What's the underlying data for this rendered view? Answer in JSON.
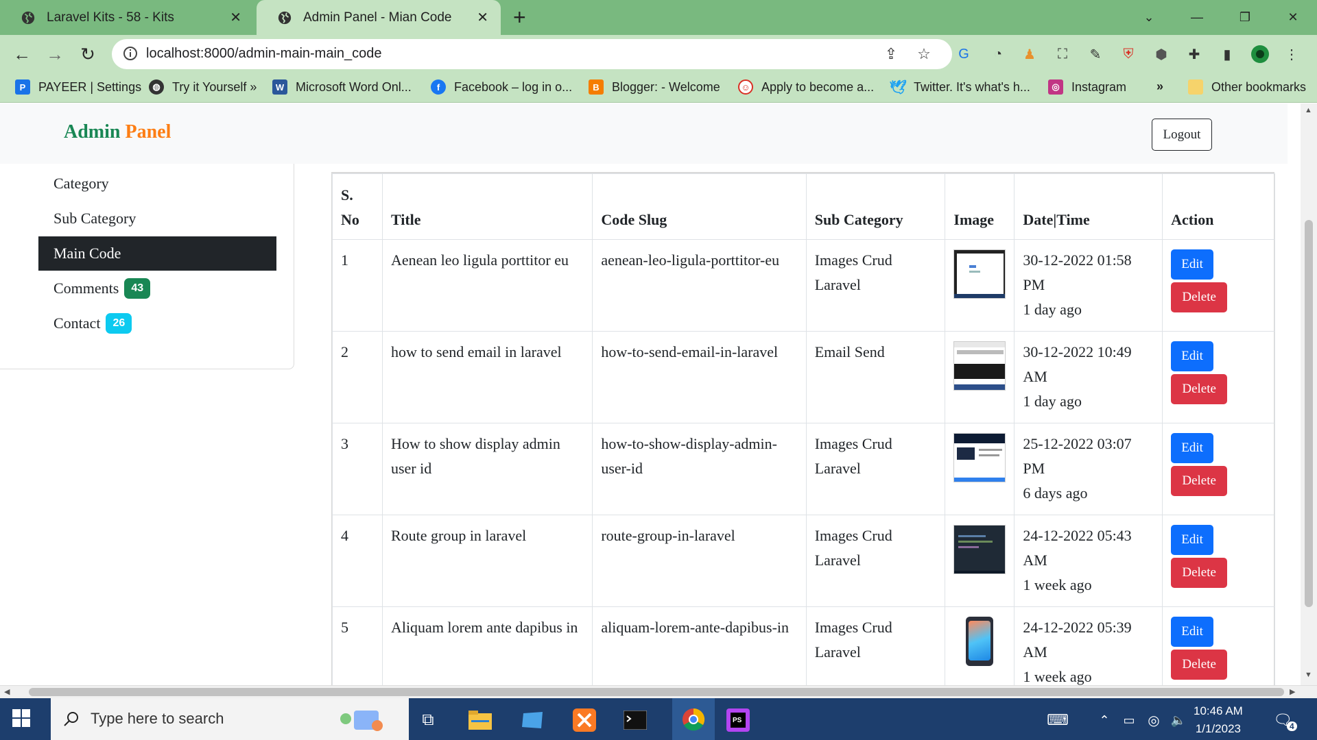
{
  "browser": {
    "tabs": [
      {
        "title": "Laravel Kits - 58 - Kits",
        "active": false
      },
      {
        "title": "Admin Panel - Mian Code",
        "active": true
      }
    ],
    "url": "localhost:8000/admin-main-main_code",
    "bookmarks": [
      {
        "label": "PAYEER | Settings",
        "icon": "payeer-icon"
      },
      {
        "label": "Try it Yourself »",
        "icon": "globe-icon"
      },
      {
        "label": "Microsoft Word Onl...",
        "icon": "word-icon"
      },
      {
        "label": "Facebook – log in o...",
        "icon": "facebook-icon"
      },
      {
        "label": "Blogger: - Welcome",
        "icon": "blogger-icon"
      },
      {
        "label": "Apply to become a...",
        "icon": "reddit-icon"
      },
      {
        "label": "Twitter. It's what's h...",
        "icon": "twitter-icon"
      },
      {
        "label": "Instagram",
        "icon": "instagram-icon"
      }
    ],
    "bookmarks_overflow": "»",
    "other_bookmarks": "Other bookmarks"
  },
  "app": {
    "brand_part1": "Admin",
    "brand_part2": "Panel",
    "logout_label": "Logout",
    "sidebar": [
      {
        "label": "Category",
        "badge": null,
        "active": false
      },
      {
        "label": "Sub Category",
        "badge": null,
        "active": false
      },
      {
        "label": "Main Code",
        "badge": null,
        "active": true
      },
      {
        "label": "Comments",
        "badge": "43",
        "badge_color": "#198754",
        "active": false
      },
      {
        "label": "Contact",
        "badge": "26",
        "badge_color": "#0dcaf0",
        "active": false
      }
    ],
    "table": {
      "headers": [
        "S. No",
        "Title",
        "Code Slug",
        "Sub Category",
        "Image",
        "Date|Time",
        "Action"
      ],
      "rows": [
        {
          "sno": "1",
          "title": "Aenean leo ligula porttitor eu",
          "slug": "aenean-leo-ligula-porttitor-eu",
          "subcategory": "Images Crud Laravel",
          "date": "30-12-2022 01:58 PM",
          "ago": "1 day ago"
        },
        {
          "sno": "2",
          "title": "how to send email in laravel",
          "slug": "how-to-send-email-in-laravel",
          "subcategory": "Email Send",
          "date": "30-12-2022 10:49 AM",
          "ago": "1 day ago"
        },
        {
          "sno": "3",
          "title": "How to show display admin user id",
          "slug": "how-to-show-display-admin-user-id",
          "subcategory": "Images Crud Laravel",
          "date": "25-12-2022 03:07 PM",
          "ago": "6 days ago"
        },
        {
          "sno": "4",
          "title": "Route group in laravel",
          "slug": "route-group-in-laravel",
          "subcategory": "Images Crud Laravel",
          "date": "24-12-2022 05:43 AM",
          "ago": "1 week ago"
        },
        {
          "sno": "5",
          "title": "Aliquam lorem ante dapibus in",
          "slug": "aliquam-lorem-ante-dapibus-in",
          "subcategory": "Images Crud Laravel",
          "date": "24-12-2022 05:39 AM",
          "ago": "1 week ago"
        }
      ],
      "edit_label": "Edit",
      "delete_label": "Delete"
    }
  },
  "taskbar": {
    "search_placeholder": "Type here to search",
    "time": "10:46 AM",
    "date": "1/1/2023",
    "notification_count": "4"
  }
}
